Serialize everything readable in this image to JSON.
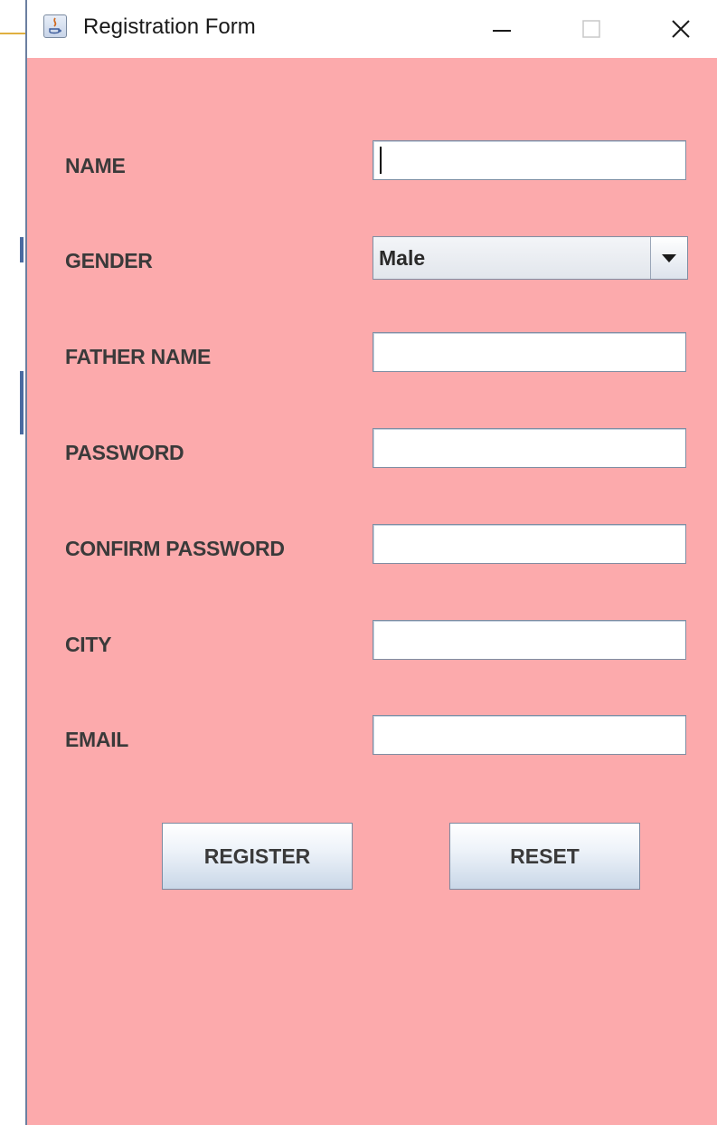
{
  "window": {
    "title": "Registration Form",
    "background_color": "#fcaaac",
    "controls": [
      "minimize-icon",
      "maximize-icon",
      "close-icon"
    ]
  },
  "form": {
    "name_label": "NAME",
    "name_value": "",
    "gender_label": "GENDER",
    "gender_selected": "Male",
    "father_name_label": "FATHER NAME",
    "father_name_value": "",
    "password_label": "PASSWORD",
    "password_value": "",
    "confirm_password_label": "CONFIRM PASSWORD",
    "confirm_password_value": "",
    "city_label": "CITY",
    "city_value": "",
    "email_label": "EMAIL",
    "email_value": ""
  },
  "buttons": {
    "register_label": "REGISTER",
    "reset_label": "RESET"
  }
}
